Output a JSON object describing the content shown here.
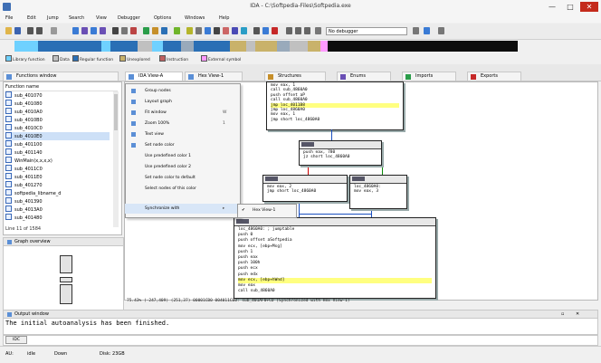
{
  "window": {
    "title": "IDA - C:\\Softpedia-Files\\Softpedia.exe",
    "controls": [
      "—",
      "□",
      "✕"
    ]
  },
  "menubar": [
    "File",
    "Edit",
    "Jump",
    "Search",
    "View",
    "Debugger",
    "Options",
    "Windows",
    "Help"
  ],
  "toolbar": {
    "debugger_select": "No debugger"
  },
  "legend": [
    {
      "label": "Library function",
      "color": "#6fd1ff"
    },
    {
      "label": "Data",
      "color": "#c0c0c0"
    },
    {
      "label": "Regular function",
      "color": "#2a6fb5"
    },
    {
      "label": "Unexplored",
      "color": "#c9b26a"
    },
    {
      "label": "Instruction",
      "color": "#c06060"
    },
    {
      "label": "External symbol",
      "color": "#ff99ff"
    }
  ],
  "tabs": [
    "Functions window",
    "IDA View-A",
    "Hex View-1",
    "Structures",
    "Enums",
    "Imports",
    "Exports"
  ],
  "functions": {
    "header": "Function name",
    "items": [
      "sub_401070",
      "sub_401080",
      "sub_4010A0",
      "sub_4010B0",
      "sub_4010C0",
      "sub_4010E0",
      "sub_401100",
      "sub_401140",
      "WinMain(x,x,x,x)",
      "sub_4011C0",
      "sub_4011E0",
      "sub_401270",
      "softpedia_libname_d",
      "sub_401390",
      "sub_4013A0",
      "sub_401480"
    ],
    "selected_index": 5,
    "line_info": "Line 11 of 1584"
  },
  "overview": {
    "header": "Graph overview"
  },
  "context_menu": [
    {
      "label": "Group nodes",
      "shortcut": ""
    },
    {
      "label": "Layout graph",
      "shortcut": ""
    },
    {
      "label": "Fit window",
      "shortcut": "W"
    },
    {
      "label": "Zoom 100%",
      "shortcut": "1"
    },
    {
      "label": "Text view",
      "shortcut": ""
    },
    {
      "label": "Set node color",
      "shortcut": ""
    },
    {
      "label": "Use predefined color 1",
      "shortcut": ""
    },
    {
      "label": "Use predefined color 2",
      "shortcut": ""
    },
    {
      "label": "Set node color to default",
      "shortcut": ""
    },
    {
      "label": "Select nodes of this color",
      "shortcut": ""
    },
    {
      "label": "Synchronize with",
      "shortcut": "▸"
    }
  ],
  "submenu": {
    "item": "Hex View-1"
  },
  "graph_blocks": {
    "b1": [
      "mov     eax, 1",
      "call    sub_4860A0",
      "push    offset aP",
      "call    sub_4860A0",
      "jmp     loc_4011B8",
      "jmp     loc_4860A0",
      "mov     eax, 1",
      "jmp     short loc_4860A0"
    ],
    "b2": [
      "push    eax, 780",
      "jz      short loc_4860A0"
    ],
    "b3": [
      "mov     eax, 2",
      "jmp     short loc_4860A0"
    ],
    "b4": [
      "loc_4860A0:",
      "mov     eax, 3"
    ],
    "b5": [
      "loc_4860A0:          ; jumptable",
      "push    0",
      "push    offset aSoftpedia",
      "mov     ecx, [ebp+Msg]",
      "push    1",
      "push    eax",
      "push    100h",
      "push    ecx",
      "push    edx",
      "mov     ecx, [ebp+hWnd]",
      "mov     eax",
      "call    sub_4860A0"
    ]
  },
  "graph_status": "75.43% (-247,409) (251,37) 00001CB0 004011CB0: sub_401AF0+CD (Synchronized with Hex View-1)",
  "output": {
    "header": "Output window",
    "text": "The initial autoanalysis has been finished.",
    "cmd_label": "IDC"
  },
  "statusbar": [
    "AU:",
    "idle",
    "Down",
    "Disk: 23GB"
  ]
}
